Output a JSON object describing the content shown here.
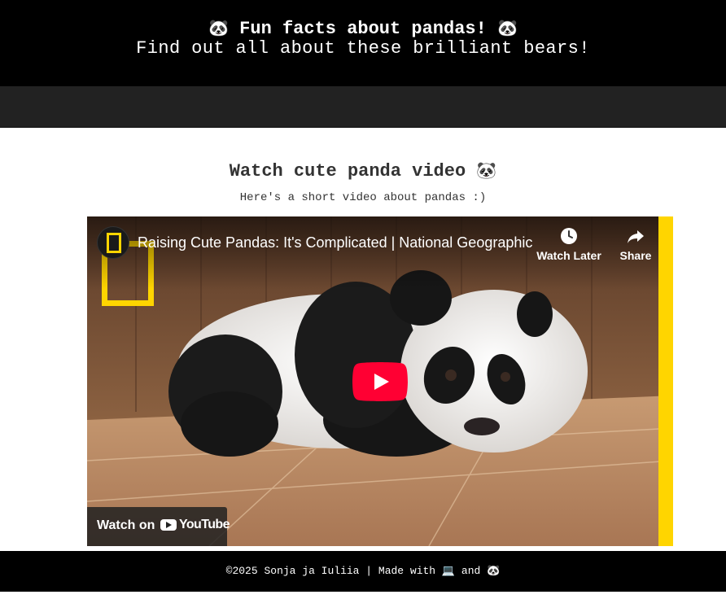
{
  "header": {
    "title_emoji_left": "🐼",
    "title": "Fun facts about pandas!",
    "title_emoji_right": "🐼",
    "subtitle": "Find out all about these brilliant bears!"
  },
  "section": {
    "title": "Watch cute panda video",
    "title_emoji": "🐼",
    "subtitle": "Here's a short video about pandas :)"
  },
  "video": {
    "title": "Raising Cute Pandas: It's Complicated | National Geographic",
    "watch_later_label": "Watch Later",
    "share_label": "Share",
    "watch_on_label": "Watch on",
    "youtube_label": "YouTube",
    "icons": [
      "clock-icon",
      "share-icon",
      "play-icon",
      "youtube-icon"
    ]
  },
  "footer": {
    "text_before": "©2025 Sonja ja Iuliia | Made with",
    "emoji_laptop": "💻",
    "text_and": "and",
    "emoji_panda": "🐼"
  },
  "colors": {
    "header_bg": "#000000",
    "nav_bg": "#222222",
    "accent_yellow": "#ffd500",
    "play_red": "#ff0033"
  }
}
